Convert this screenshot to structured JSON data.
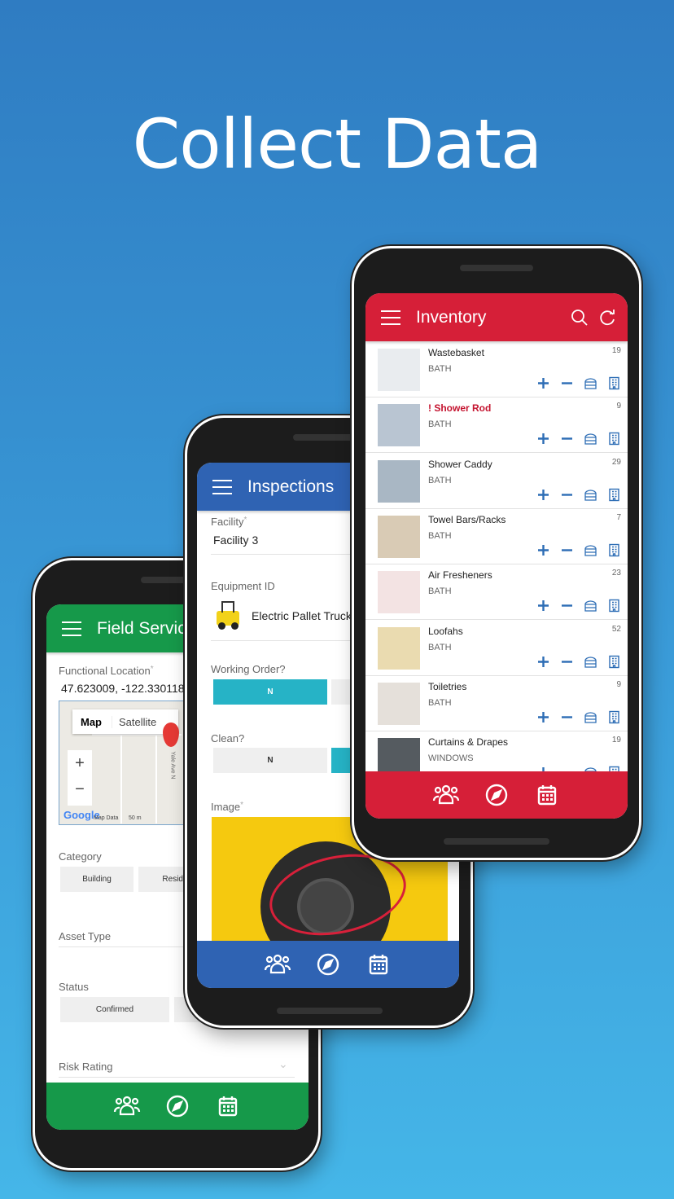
{
  "headline": "Collect Data",
  "colors": {
    "field_service": "#16994a",
    "inspections": "#2f63b3",
    "inventory": "#d61f38",
    "toggle_on": "#26b3c6",
    "action_blue": "#2d6db5"
  },
  "field_service": {
    "title": "Field Service",
    "menu_icon": "hamburger-icon",
    "functional_location": {
      "label": "Functional Location",
      "value": "47.623009, -122.330118"
    },
    "map": {
      "tab_map": "Map",
      "tab_satellite": "Satellite",
      "zoom_in": "+",
      "zoom_out": "−",
      "google": "Google",
      "map_data": "Map Data",
      "scale": "50 m",
      "street": "Yale Ave N"
    },
    "category": {
      "label": "Category",
      "options": [
        "Building",
        "Reside"
      ]
    },
    "asset_type": {
      "label": "Asset Type"
    },
    "status": {
      "label": "Status",
      "options": [
        "Confirmed"
      ]
    },
    "risk_rating": {
      "label": "Risk Rating"
    },
    "nav": [
      "people-icon",
      "compass-icon",
      "calendar-icon"
    ]
  },
  "inspections": {
    "title": "Inspections",
    "facility": {
      "label": "Facility",
      "value": "Facility 3"
    },
    "equipment": {
      "label": "Equipment ID",
      "value": "Electric Pallet Truck"
    },
    "working_order": {
      "label": "Working Order?",
      "selected": "N"
    },
    "clean": {
      "label": "Clean?",
      "option": "N"
    },
    "image": {
      "label": "Image"
    }
  },
  "inventory": {
    "title": "Inventory",
    "items": [
      {
        "name": "Wastebasket",
        "category": "BATH",
        "count": "19",
        "alert": false,
        "thumb": "#e9ecef"
      },
      {
        "name": "Shower Rod",
        "category": "BATH",
        "count": "9",
        "alert": true,
        "thumb": "#b9c5d2"
      },
      {
        "name": "Shower Caddy",
        "category": "BATH",
        "count": "29",
        "alert": false,
        "thumb": "#a9b7c4"
      },
      {
        "name": "Towel Bars/Racks",
        "category": "BATH",
        "count": "7",
        "alert": false,
        "thumb": "#d9cbb5"
      },
      {
        "name": "Air Fresheners",
        "category": "BATH",
        "count": "23",
        "alert": false,
        "thumb": "#f3e3e3"
      },
      {
        "name": "Loofahs",
        "category": "BATH",
        "count": "52",
        "alert": false,
        "thumb": "#eadbb0"
      },
      {
        "name": "Toiletries",
        "category": "BATH",
        "count": "9",
        "alert": false,
        "thumb": "#e5e0da"
      },
      {
        "name": "Curtains & Drapes",
        "category": "WINDOWS",
        "count": "19",
        "alert": false,
        "thumb": "#555b60"
      }
    ]
  }
}
